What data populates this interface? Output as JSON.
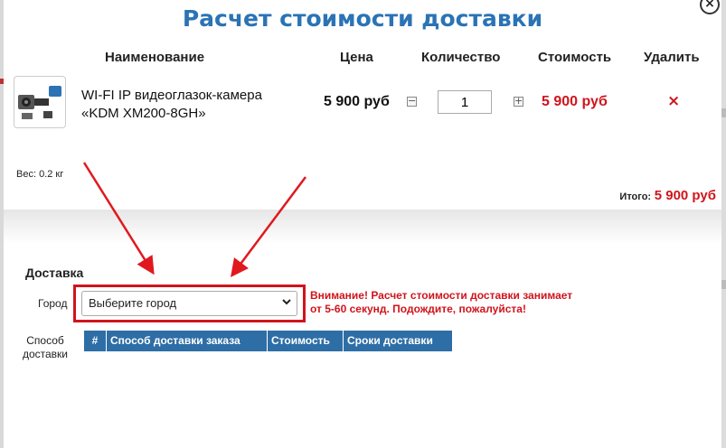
{
  "dialog": {
    "title": "Расчет стоимости доставки",
    "close_label": "×"
  },
  "cart": {
    "columns": {
      "name": "Наименование",
      "price": "Цена",
      "quantity": "Количество",
      "cost": "Стоимость",
      "delete": "Удалить"
    },
    "item": {
      "name": "WI-FI IP видеоглазок-камера «KDM XM200-8GH»",
      "price": "5 900 руб",
      "quantity": "1",
      "cost": "5 900 руб",
      "delete_symbol": "×",
      "minus_symbol": "−",
      "plus_symbol": "+"
    },
    "weight": "Вес: 0.2 кг",
    "total_label": "Итого:",
    "total_value": "5 900 руб"
  },
  "delivery": {
    "heading": "Доставка",
    "city_label": "Город",
    "city_select_value": "Выберите город",
    "warning": "Внимание! Расчет стоимости доставки занимает от 5-60 секунд. Подождите, пожалуйста!",
    "method_label": "Способ доставки",
    "table_headers": [
      "#",
      "Способ доставки заказа",
      "Стоимость",
      "Сроки доставки"
    ]
  },
  "colors": {
    "title": "#2b73b5",
    "accent_red": "#d0141c",
    "table_header": "#2e6ea6",
    "annotation": "#e0191f"
  },
  "icons": {
    "close": "close-icon",
    "delete": "delete-icon",
    "select": "chevron-down-icon",
    "product": "camera-icon"
  }
}
